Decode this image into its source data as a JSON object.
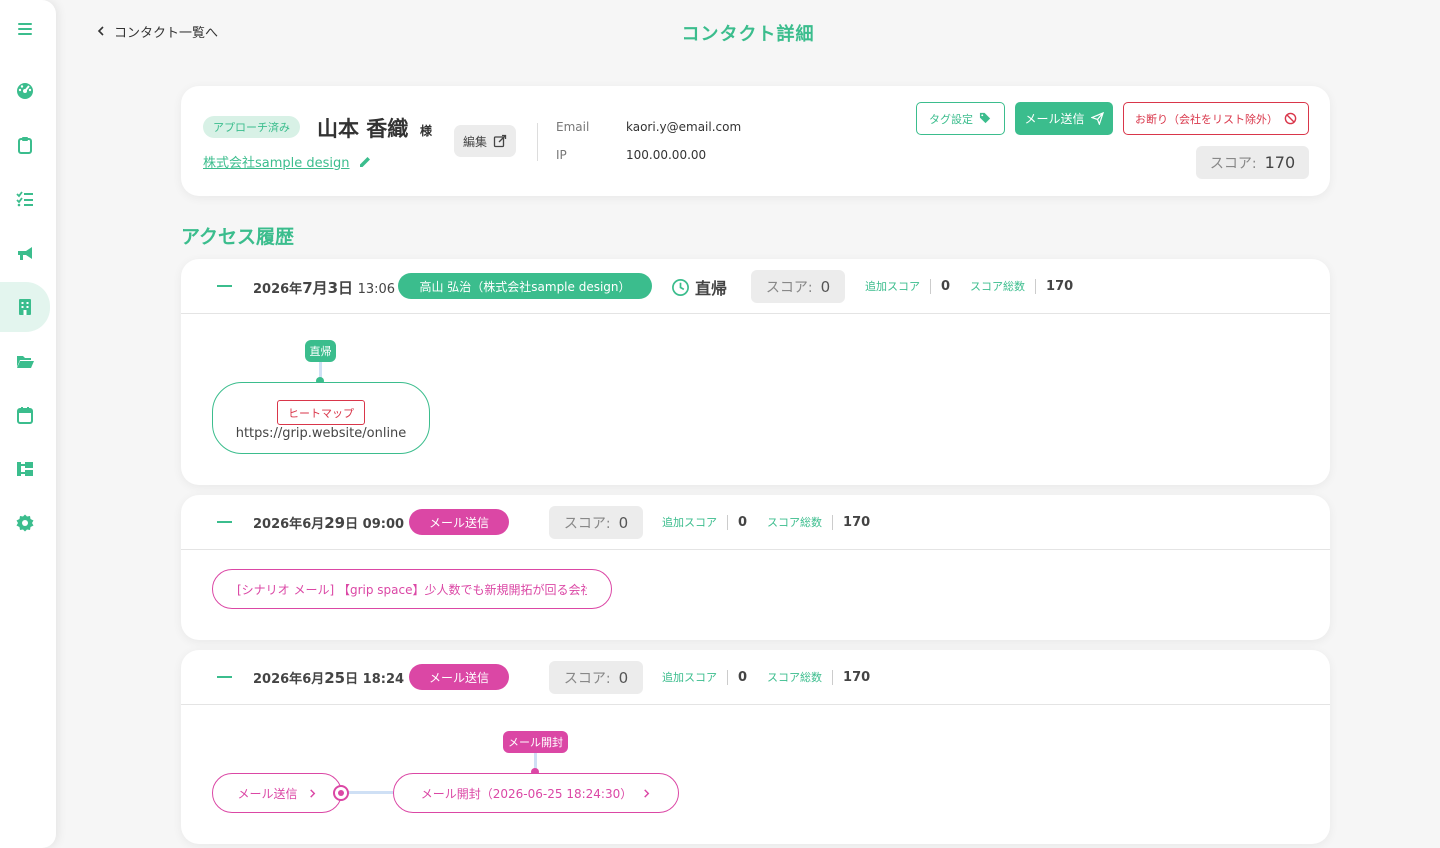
{
  "header": {
    "back_label": "コンタクト一覧へ",
    "title": "コンタクト詳細"
  },
  "sidebar": {
    "items": [
      {
        "icon": "menu-icon"
      },
      {
        "icon": "dashboard-gauge-icon"
      },
      {
        "icon": "clipboard-icon"
      },
      {
        "icon": "checklist-icon"
      },
      {
        "icon": "megaphone-icon"
      },
      {
        "icon": "building-icon",
        "active": true
      },
      {
        "icon": "folder-open-icon"
      },
      {
        "icon": "calendar-icon"
      },
      {
        "icon": "sitemap-icon"
      },
      {
        "icon": "gear-icon"
      }
    ]
  },
  "contact": {
    "status": "アプローチ済み",
    "name": "山本 香織",
    "honorific": "様",
    "company": "株式会社sample design",
    "edit_label": "編集",
    "email_label": "Email",
    "email": "kaori.y@email.com",
    "ip_label": "IP",
    "ip": "100.00.00.00",
    "tag_button": "タグ設定",
    "mail_button": "メール送信",
    "decline_button": "お断り（会社をリスト除外）",
    "score_label": "スコア:",
    "score_value": "170"
  },
  "history_title": "アクセス履歴",
  "history": [
    {
      "date_prefix": "2026年7月3日",
      "date_pre": "2026年",
      "date_mid": "7月3日",
      "time": "13:06",
      "visitor": "高山 弘治（株式会社sample design）",
      "direct_label": "直帰",
      "score_label": "スコア:",
      "score": "0",
      "add_label": "追加スコア",
      "add_value": "0",
      "total_label": "スコア総数",
      "total_value": "170",
      "flow": {
        "tag": "直帰",
        "heatmap": "ヒートマップ",
        "url": "https://grip.website/online"
      }
    },
    {
      "date_pre": "2026年",
      "date_month": "6月",
      "date_day": "29",
      "date_suffix": "日",
      "time": "09:00",
      "type": "メール送信",
      "score_label": "スコア:",
      "score": "0",
      "add_label": "追加スコア",
      "add_value": "0",
      "total_label": "スコア総数",
      "total_value": "170",
      "flow": {
        "mail_subject": "[シナリオ メール] 【grip space】少人数でも新規開拓が回る会社"
      }
    },
    {
      "date_pre": "2026年",
      "date_month": "6月",
      "date_day": "25",
      "date_suffix": "日",
      "time": "18:24",
      "type": "メール送信",
      "score_label": "スコア:",
      "score": "0",
      "add_label": "追加スコア",
      "add_value": "0",
      "total_label": "スコア総数",
      "total_value": "170",
      "flow": {
        "open_tag": "メール開封",
        "send_node": "メール送信",
        "open_node": "メール開封（2026-06-25 18:24:30）"
      }
    }
  ],
  "colors": {
    "accent": "#3bbd8d",
    "pink": "#db47a5",
    "danger": "#d9364a"
  }
}
